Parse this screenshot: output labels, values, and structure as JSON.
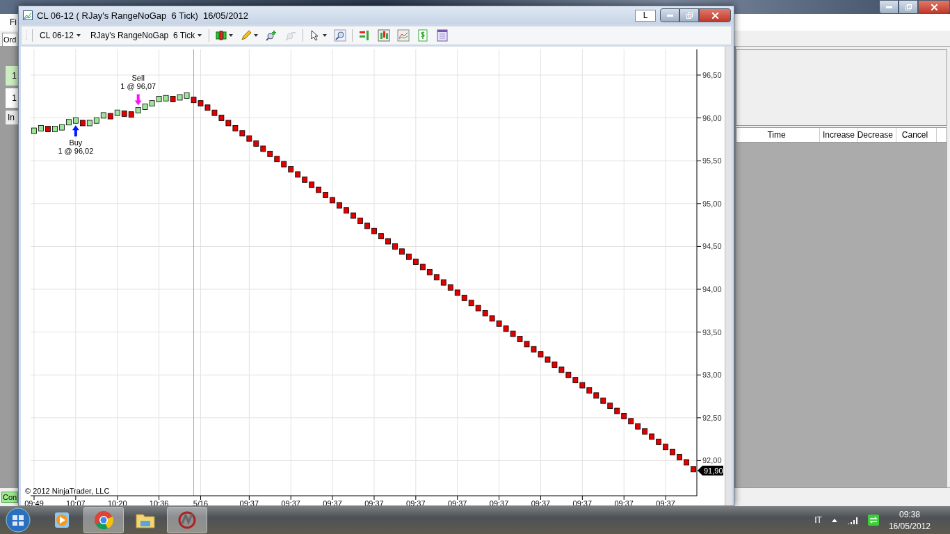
{
  "app": {
    "menu": [
      "Fi"
    ],
    "tab": "Ord",
    "left_cells": [
      {
        "text": "1",
        "selected": true
      },
      {
        "text": "1",
        "selected": false
      }
    ],
    "left_header": "In",
    "status": "Con",
    "columns": [
      "Time",
      "Increase",
      "Decrease",
      "Cancel"
    ]
  },
  "chart_window": {
    "title": "CL 06-12 ( RJay's RangeNoGap  6 Tick)  16/05/2012",
    "link_button": "L",
    "instrument": "CL 06-12",
    "bar_type": "RJay's RangeNoGap  6 Tick",
    "tools": [
      {
        "kind": "candles",
        "dropdown": true,
        "disabled": false
      },
      {
        "kind": "pencil",
        "dropdown": true,
        "disabled": false
      },
      {
        "kind": "zoom-in",
        "dropdown": false,
        "disabled": false
      },
      {
        "kind": "zoom-out",
        "dropdown": false,
        "disabled": true
      },
      {
        "kind": "pointer",
        "dropdown": true,
        "disabled": false
      },
      {
        "kind": "search",
        "dropdown": false,
        "disabled": false
      },
      {
        "kind": "strategy",
        "dropdown": false,
        "disabled": false
      },
      {
        "kind": "bars",
        "dropdown": false,
        "disabled": false
      },
      {
        "kind": "graph",
        "dropdown": false,
        "disabled": false
      },
      {
        "kind": "dollar",
        "dropdown": false,
        "disabled": false
      },
      {
        "kind": "properties",
        "dropdown": false,
        "disabled": false
      }
    ],
    "chart_data": {
      "type": "scatter",
      "grid": true,
      "categories": [
        "09:49",
        null,
        null,
        null,
        null,
        null,
        "10:07",
        null,
        null,
        null,
        null,
        null,
        "10:20",
        null,
        null,
        null,
        null,
        null,
        "10:36",
        null,
        null,
        null,
        null,
        null,
        "5/16",
        null,
        null,
        null,
        null,
        null,
        null,
        "09:37",
        null,
        null,
        null,
        null,
        null,
        "09:37",
        null,
        null,
        null,
        null,
        null,
        "09:37",
        null,
        null,
        null,
        null,
        null,
        "09:37",
        null,
        null,
        null,
        null,
        null,
        "09:37",
        null,
        null,
        null,
        null,
        null,
        "09:37",
        null,
        null,
        null,
        null,
        null,
        "09:37",
        null,
        null,
        null,
        null,
        null,
        "09:37",
        null,
        null,
        null,
        null,
        null,
        "09:37",
        null,
        null,
        null,
        null,
        null,
        "09:37",
        null,
        null,
        null,
        null,
        null,
        "09:37",
        null,
        null,
        null,
        null
      ],
      "series": [
        {
          "color": "#9ee59a",
          "values": [
            95.85,
            95.88,
            null,
            95.87,
            95.89,
            95.95,
            95.97,
            null,
            95.94,
            95.97,
            96.03,
            null,
            96.06,
            null,
            null,
            96.09,
            96.13,
            96.17,
            96.22,
            96.23,
            null,
            96.24,
            96.26,
            null,
            null,
            null,
            null,
            null,
            null,
            null,
            null,
            null,
            null,
            null,
            null,
            null,
            null,
            null,
            null,
            null,
            null,
            null,
            null,
            null,
            null,
            null,
            null,
            null,
            null,
            null,
            null,
            null,
            null,
            null,
            null,
            null,
            null,
            null,
            null,
            null,
            null,
            null,
            null,
            null,
            null,
            null,
            null,
            null,
            null,
            null,
            null,
            null,
            null,
            null,
            null,
            null,
            null,
            null,
            null,
            null,
            null,
            null,
            null,
            null,
            null,
            null,
            null,
            null,
            null,
            null,
            null,
            null,
            null,
            null,
            null,
            null
          ]
        },
        {
          "color": "#e00000",
          "values": [
            null,
            null,
            95.87,
            null,
            null,
            null,
            null,
            95.94,
            null,
            null,
            null,
            96.02,
            null,
            96.05,
            96.04,
            null,
            null,
            null,
            null,
            null,
            96.22,
            null,
            null,
            96.21,
            96.17,
            96.12,
            96.06,
            96.0,
            95.94,
            95.88,
            95.82,
            95.76,
            95.7,
            95.64,
            95.58,
            95.52,
            95.46,
            95.4,
            95.34,
            95.28,
            95.22,
            95.16,
            95.1,
            95.04,
            94.98,
            94.92,
            94.86,
            94.8,
            94.74,
            94.68,
            94.62,
            94.56,
            94.5,
            94.44,
            94.38,
            94.32,
            94.26,
            94.2,
            94.14,
            94.08,
            94.02,
            93.96,
            93.9,
            93.84,
            93.78,
            93.72,
            93.66,
            93.6,
            93.54,
            93.48,
            93.42,
            93.36,
            93.3,
            93.24,
            93.18,
            93.12,
            93.06,
            93.0,
            92.94,
            92.88,
            92.82,
            92.76,
            92.7,
            92.64,
            92.58,
            92.52,
            92.46,
            92.4,
            92.34,
            92.28,
            92.22,
            92.16,
            92.1,
            92.04,
            91.98,
            91.9
          ]
        }
      ],
      "ylim": [
        91.59,
        96.8
      ],
      "yticks": [
        {
          "value": 96.5,
          "label": "96,50"
        },
        {
          "value": 96,
          "label": "96,00"
        },
        {
          "value": 95.5,
          "label": "95,50"
        },
        {
          "value": 95,
          "label": "95,00"
        },
        {
          "value": 94.5,
          "label": "94,50"
        },
        {
          "value": 94,
          "label": "94,00"
        },
        {
          "value": 93.5,
          "label": "93,50"
        },
        {
          "value": 93,
          "label": "93,00"
        },
        {
          "value": 92.5,
          "label": "92,50"
        },
        {
          "value": 92,
          "label": "92,00"
        }
      ],
      "annotations": [
        "Buy",
        "1 @ 96,02",
        "Sell",
        "1 @ 96,07"
      ]
    },
    "executions": [
      {
        "kind": "buy"
      },
      {
        "kind": "sell"
      }
    ],
    "price_marker": "91,90",
    "copyright": "© 2012 NinjaTrader, LLC"
  },
  "taskbar": {
    "apps": [
      {
        "kind": "media",
        "running": false
      },
      {
        "kind": "browser",
        "running": true
      },
      {
        "kind": "folder",
        "running": false
      },
      {
        "kind": "trader",
        "running": true
      }
    ],
    "language": "IT",
    "time": "09:38",
    "date": "16/05/2012"
  }
}
